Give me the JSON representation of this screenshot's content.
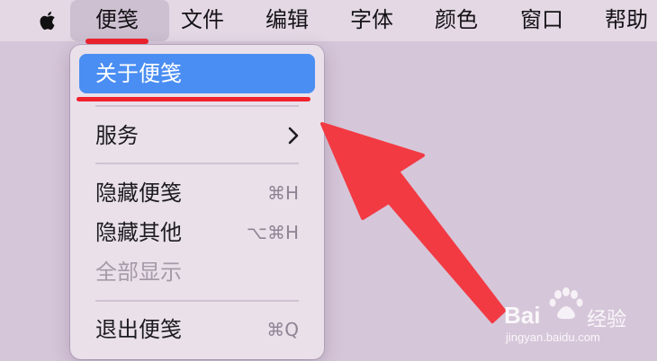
{
  "menubar": {
    "apple_icon": "apple-logo-icon",
    "items": [
      {
        "label": "便笺"
      },
      {
        "label": "文件"
      },
      {
        "label": "编辑"
      },
      {
        "label": "字体"
      },
      {
        "label": "颜色"
      },
      {
        "label": "窗口"
      },
      {
        "label": "帮助"
      }
    ]
  },
  "app_menu": {
    "items": [
      {
        "label": "关于便笺",
        "shortcut": "",
        "state": "selected"
      },
      {
        "label": "服务",
        "shortcut": "",
        "submenu_icon": "chevron-right-icon"
      },
      {
        "label": "隐藏便笺",
        "shortcut": "⌘H"
      },
      {
        "label": "隐藏其他",
        "shortcut": "⌥⌘H"
      },
      {
        "label": "全部显示",
        "shortcut": "",
        "state": "disabled"
      },
      {
        "label": "退出便笺",
        "shortcut": "⌘Q"
      }
    ]
  },
  "annotations": {
    "color": "#f0222d",
    "icon": "red-arrow"
  },
  "watermark": {
    "brand": "Bai",
    "brand_suffix": "经验",
    "url": "jingyan.baidu.com"
  },
  "colors": {
    "menubar_bg": "#e3d8e4",
    "menu_bg": "#e9e0ea",
    "highlight": "#4b8ef3",
    "desktop": "#d6c6d9"
  }
}
